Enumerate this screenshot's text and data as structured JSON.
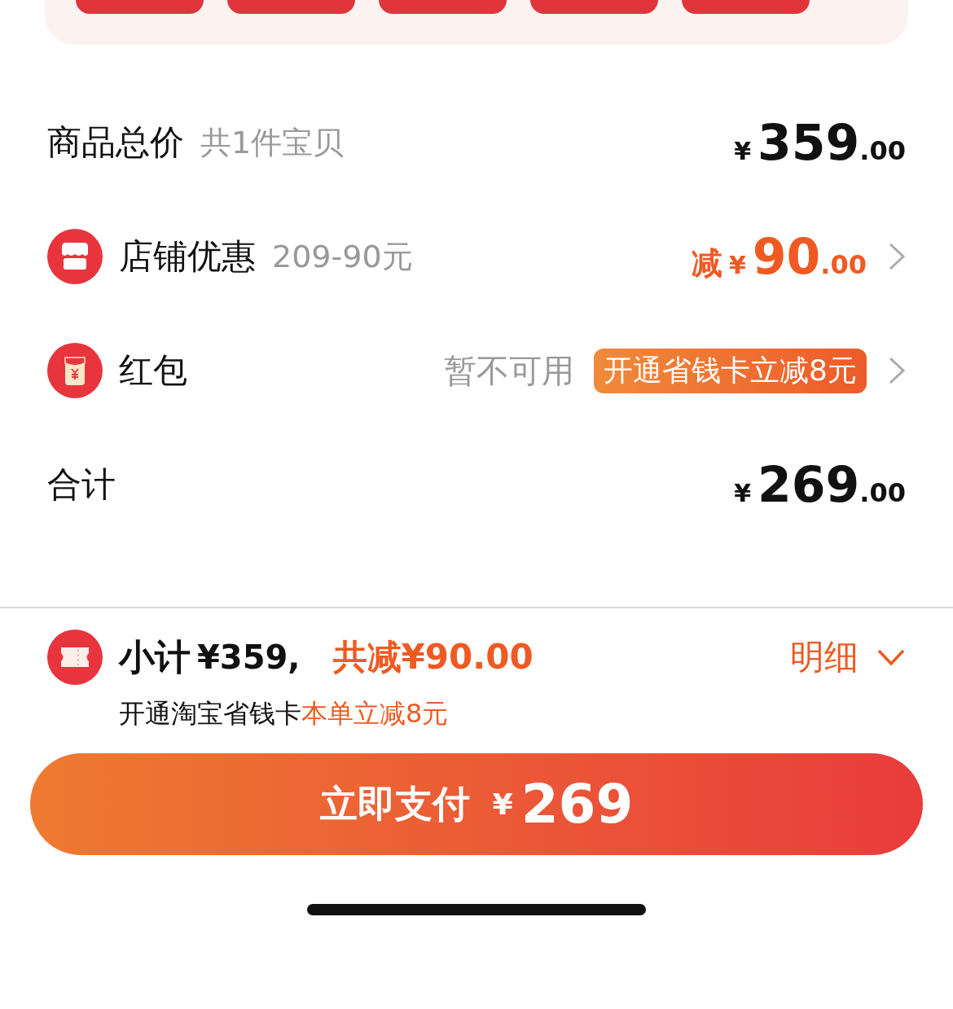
{
  "quick_options": [
    {
      "kind": "chip"
    },
    {
      "kind": "chip"
    },
    {
      "kind": "chip"
    },
    {
      "kind": "chip"
    },
    {
      "kind": "chip"
    }
  ],
  "rows": [
    {
      "kind": "total",
      "label": "商品总价",
      "note": "共1件宝贝",
      "currency": "¥",
      "amount": "359",
      "cents": ".00"
    },
    {
      "kind": "discount",
      "label": "店铺优惠",
      "note": "209-90元",
      "prefix": "减",
      "currency": "¥",
      "amount": "90",
      "cents": ".00"
    },
    {
      "kind": "packet",
      "label": "红包",
      "status": "暂不可用",
      "badge": "开通省钱卡立减8元"
    },
    {
      "kind": "total",
      "label": "合计",
      "currency": "¥",
      "amount": "269",
      "cents": ".00"
    }
  ],
  "summary": {
    "label": "小计",
    "subtotal": "¥359,",
    "discount": "共减¥90.00",
    "detail": "明细",
    "promo": "开通淘宝省钱卡",
    "promo_highlight": "本单立减8元"
  },
  "pay_button": {
    "label": "立即支付",
    "currency": "¥",
    "amount": "269"
  }
}
